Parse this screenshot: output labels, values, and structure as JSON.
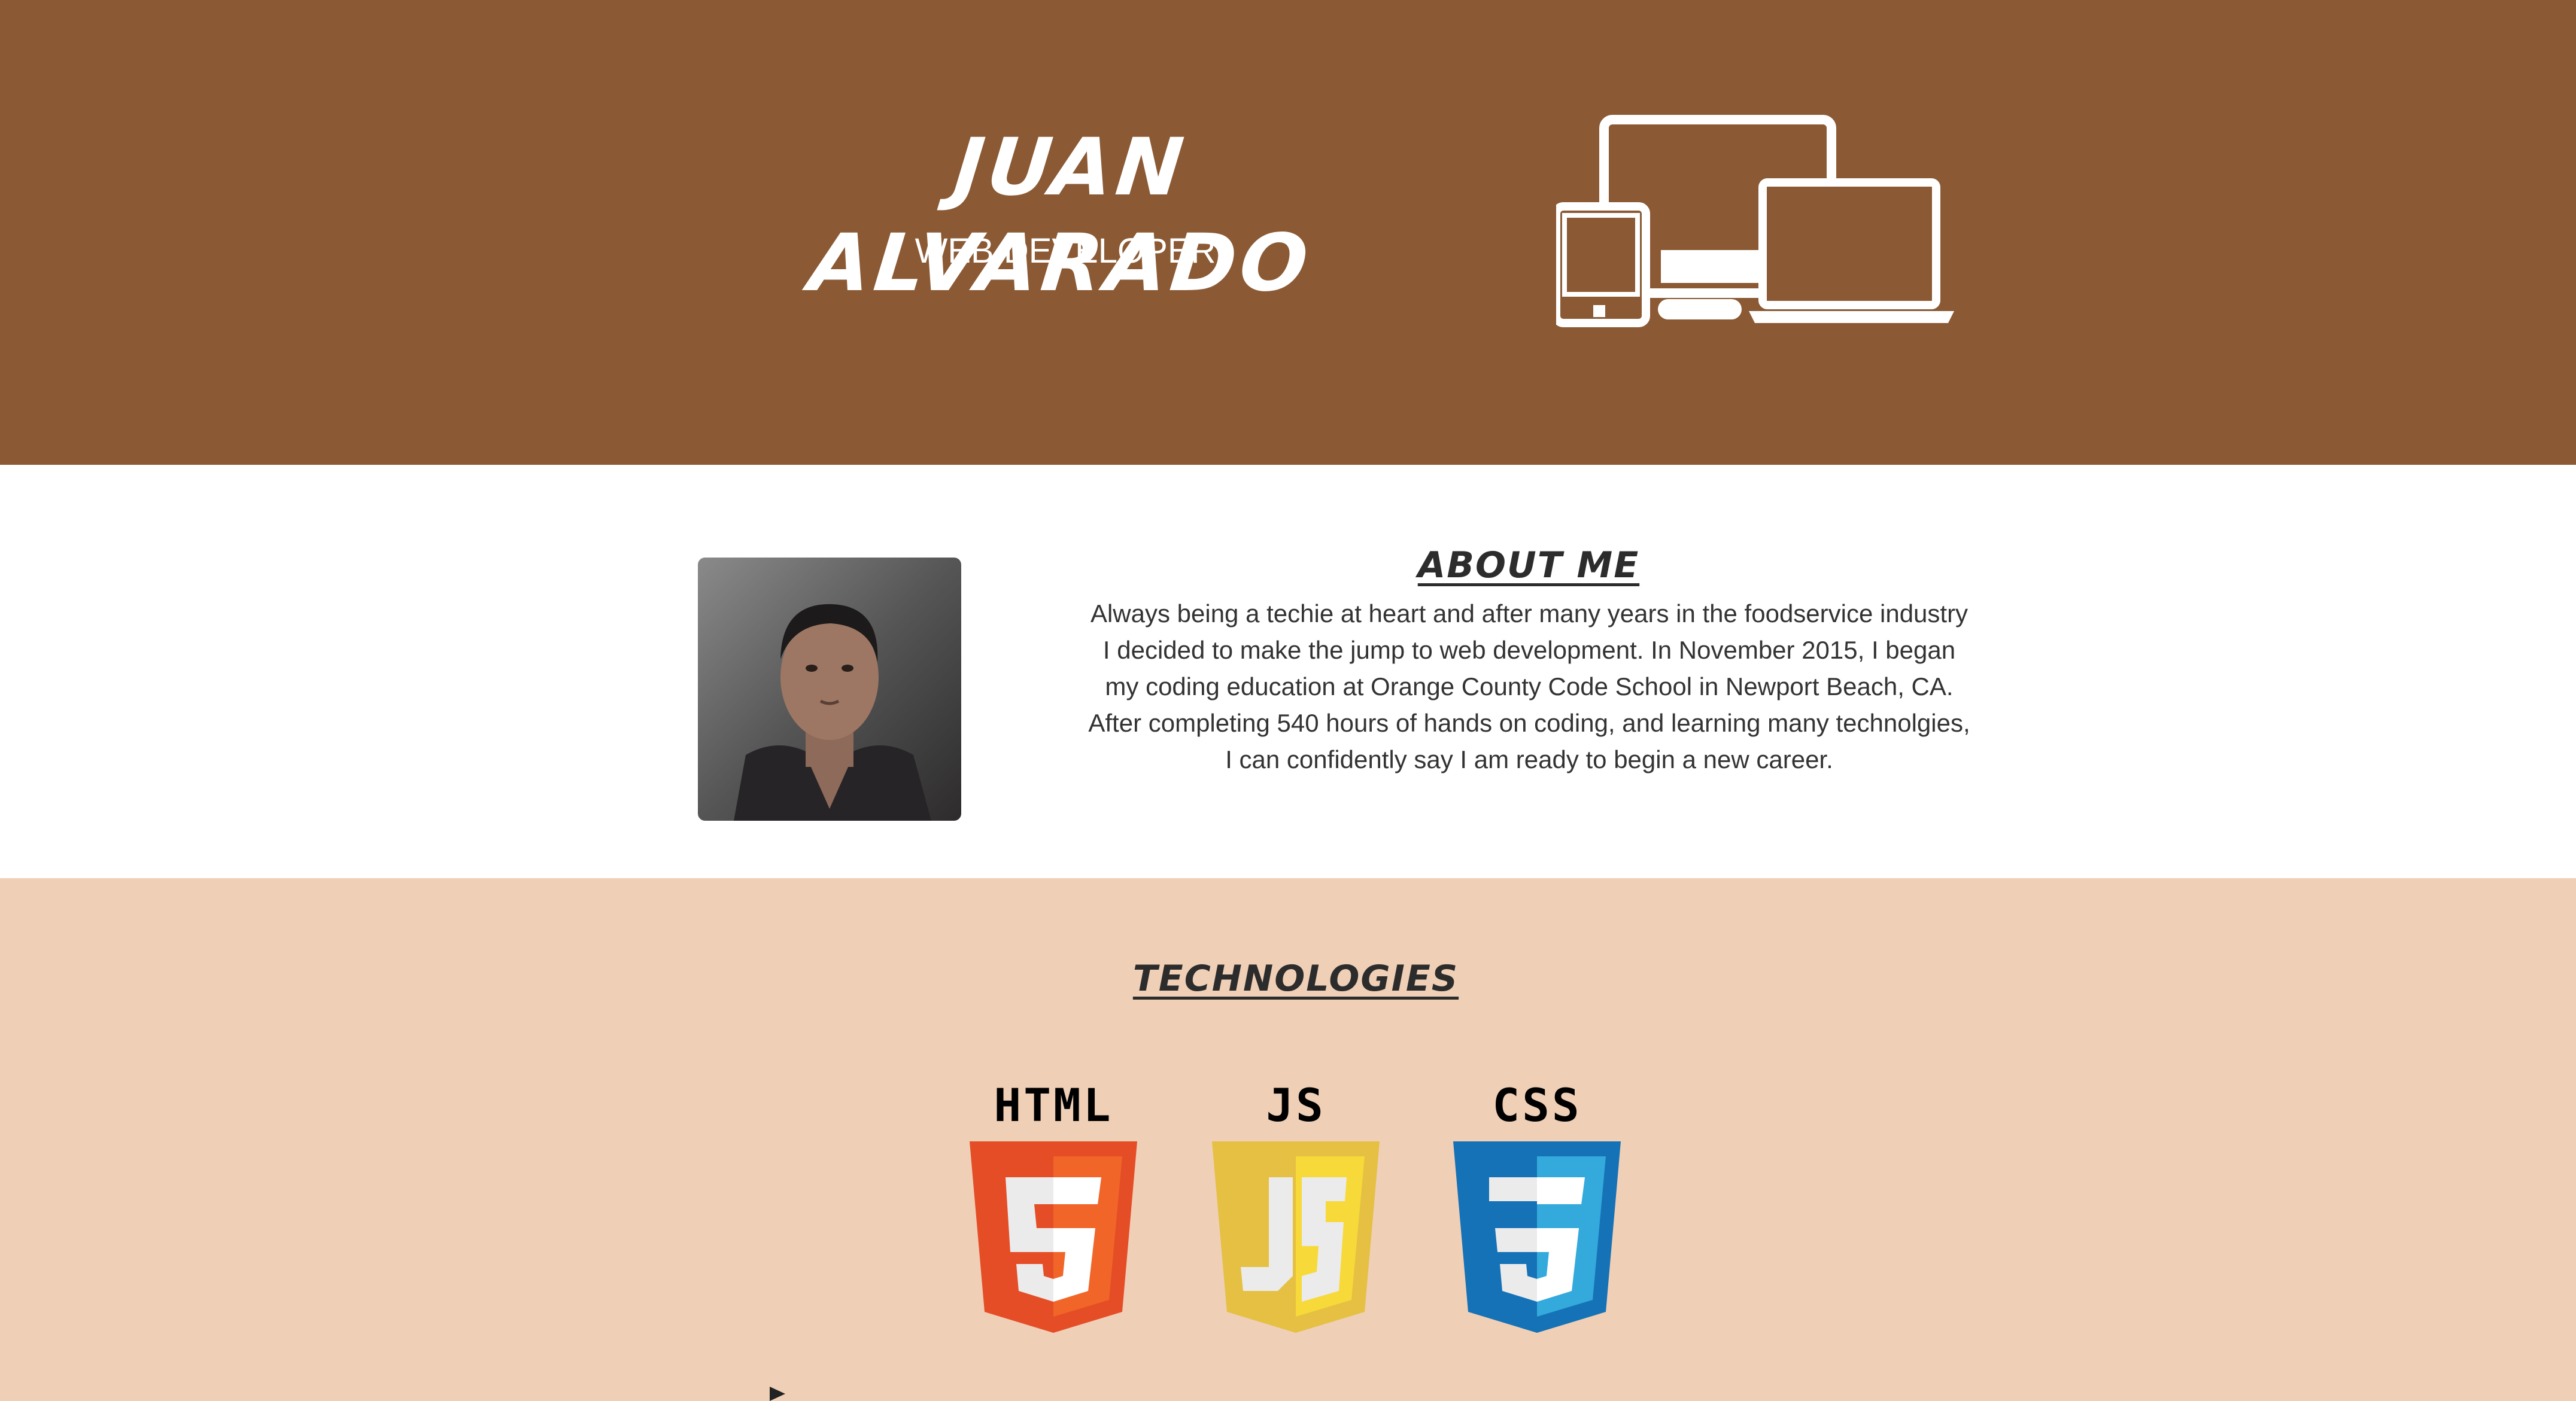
{
  "header": {
    "name": "Juan Alvarado",
    "role": "WEB DEVELOPER",
    "devices_icon": "devices-icon"
  },
  "about": {
    "title": "ABOUT ME",
    "photo_icon": "profile-photo",
    "lines": [
      "Always being a techie at heart and after many years in the foodservice industry",
      "I decided to make the jump to web development. In November 2015, I began",
      "my coding education at Orange County Code School in Newport Beach, CA.",
      "After completing 540 hours of hands on coding, and learning many technolgies,",
      "I can confidently say I am ready to begin a new career."
    ]
  },
  "technologies": {
    "title": "TECHNOLOGIES",
    "items": [
      {
        "label": "HTML",
        "digit": "5",
        "icon": "html5-icon",
        "dark": "#e44d26",
        "light": "#f16529"
      },
      {
        "label": "JS",
        "digit": "JS",
        "icon": "js-icon",
        "dark": "#e5c042",
        "light": "#f7d93a"
      },
      {
        "label": "CSS",
        "digit": "3",
        "icon": "css3-icon",
        "dark": "#1572b6",
        "light": "#33a9dc"
      }
    ]
  },
  "colors": {
    "header_bg": "#8b5a34",
    "about_bg": "#ffffff",
    "tech_bg": "#efcfb6"
  }
}
